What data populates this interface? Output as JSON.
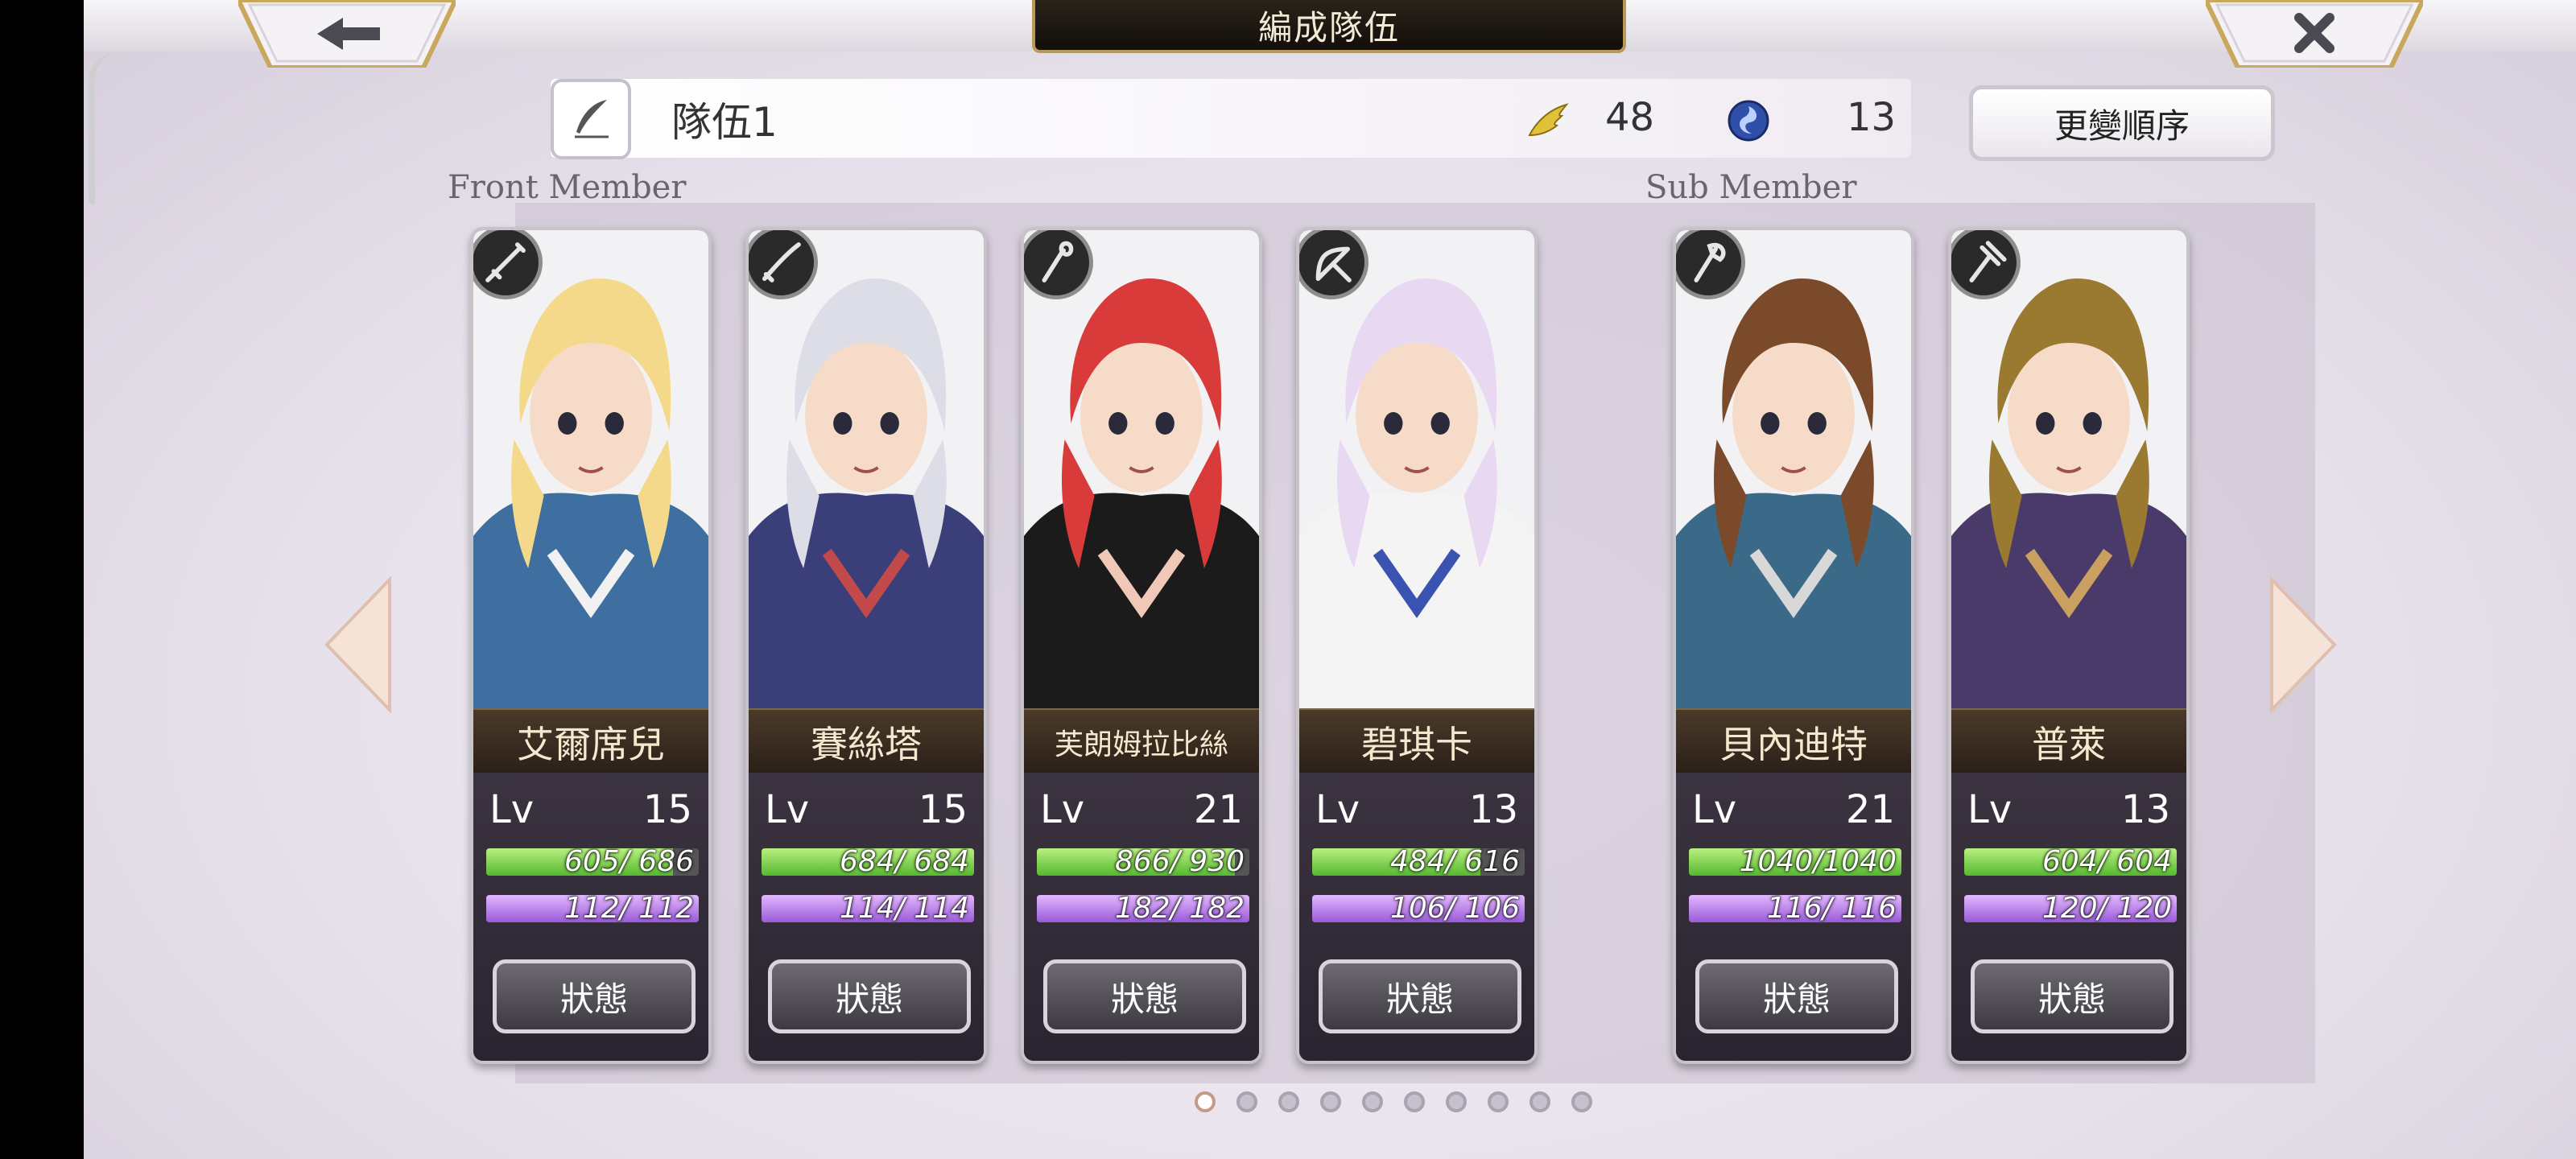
{
  "header": {
    "title": "編成隊伍",
    "back_icon": "back-arrow-icon",
    "close_icon": "close-icon"
  },
  "team": {
    "name": "隊伍1",
    "wing_count": "48",
    "orb_count": "13",
    "change_order_label": "更變順序"
  },
  "sections": {
    "front_label": "Front Member",
    "sub_label": "Sub Member"
  },
  "members": [
    {
      "name": "艾爾席兒",
      "level_label": "Lv",
      "level": "15",
      "hp_text": "605/ 686",
      "hp_frac": 0.88,
      "mp_text": "112/ 112",
      "mp_frac": 1.0,
      "state_label": "狀態",
      "class_icon": "sword-icon"
    },
    {
      "name": "賽絲塔",
      "level_label": "Lv",
      "level": "15",
      "hp_text": "684/ 684",
      "hp_frac": 1.0,
      "mp_text": "114/ 114",
      "mp_frac": 1.0,
      "state_label": "狀態",
      "class_icon": "katana-icon"
    },
    {
      "name": "芙朗姆拉比絲",
      "level_label": "Lv",
      "level": "21",
      "hp_text": "866/ 930",
      "hp_frac": 0.93,
      "mp_text": "182/ 182",
      "mp_frac": 1.0,
      "state_label": "狀態",
      "class_icon": "staff-icon"
    },
    {
      "name": "碧琪卡",
      "level_label": "Lv",
      "level": "13",
      "hp_text": "484/ 616",
      "hp_frac": 0.79,
      "mp_text": "106/ 106",
      "mp_frac": 1.0,
      "state_label": "狀態",
      "class_icon": "bow-icon"
    },
    {
      "name": "貝內迪特",
      "level_label": "Lv",
      "level": "21",
      "hp_text": "1040/1040",
      "hp_frac": 1.0,
      "mp_text": "116/ 116",
      "mp_frac": 1.0,
      "state_label": "狀態",
      "class_icon": "axe-icon"
    },
    {
      "name": "普萊",
      "level_label": "Lv",
      "level": "13",
      "hp_text": "604/ 604",
      "hp_frac": 1.0,
      "mp_text": "120/ 120",
      "mp_frac": 1.0,
      "state_label": "狀態",
      "class_icon": "hammer-icon"
    }
  ],
  "pagination": {
    "total": 10,
    "current": 1
  },
  "colors": {
    "hp": "#56b830",
    "mp": "#9a5ad8",
    "frame": "#b89a55"
  }
}
